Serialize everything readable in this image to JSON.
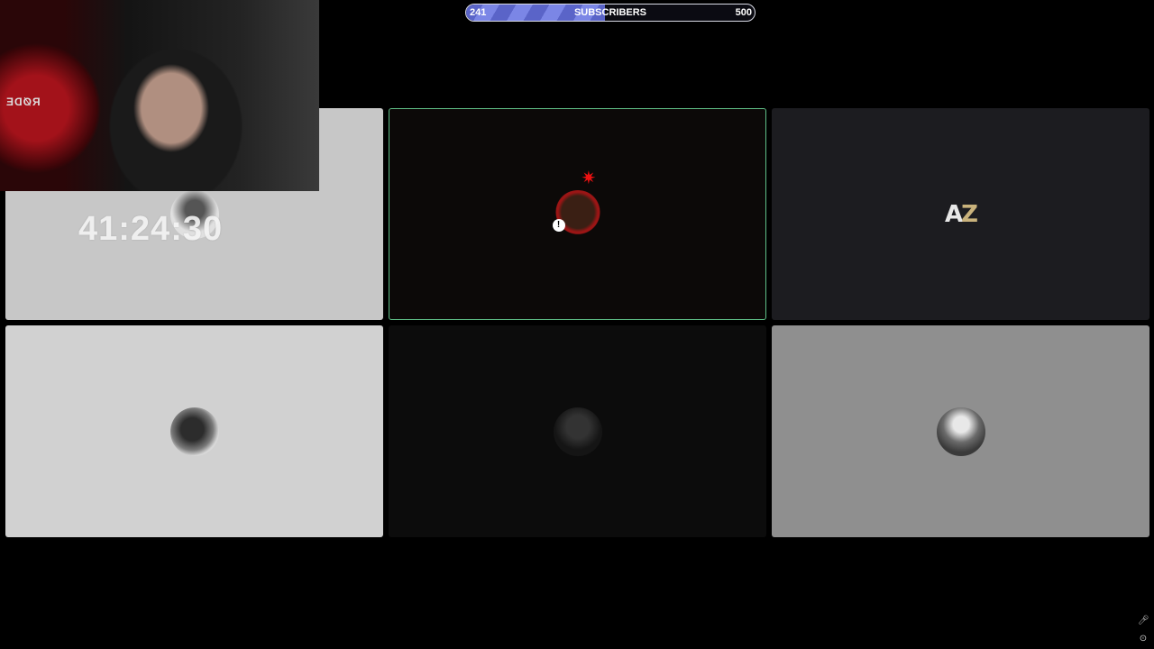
{
  "goal": {
    "current": "241",
    "label": "SUBSCRIBERS",
    "target": "500",
    "progress_fraction": 0.482
  },
  "timer": {
    "text": "41:24:30"
  },
  "webcam": {
    "mic_brand": "RØDE"
  },
  "tiles": [
    {
      "id": "participant-1",
      "speaking": false
    },
    {
      "id": "participant-2",
      "speaking": true,
      "badge_icon": "mute-icon"
    },
    {
      "id": "participant-3",
      "speaking": false,
      "logo_text_a": "A",
      "logo_text_z": "Z"
    },
    {
      "id": "participant-4",
      "speaking": false
    },
    {
      "id": "participant-5",
      "speaking": false
    },
    {
      "id": "participant-6",
      "speaking": false
    }
  ],
  "icons": {
    "mic": "microphone-icon",
    "settings": "settings-icon"
  },
  "colors": {
    "goal_fill": "#6a75d8",
    "speaking_border": "#5fbf87"
  }
}
